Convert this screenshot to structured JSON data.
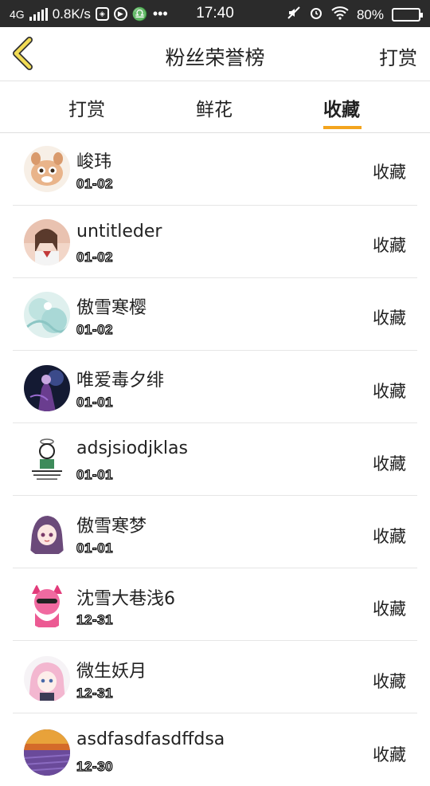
{
  "status_bar": {
    "network": "4G",
    "speed": "0.8K/s",
    "time": "17:40",
    "battery": "80%"
  },
  "header": {
    "title": "粉丝荣誉榜",
    "right_link": "打赏"
  },
  "tabs": [
    {
      "label": "打赏",
      "active": false
    },
    {
      "label": "鲜花",
      "active": false
    },
    {
      "label": "收藏",
      "active": true
    }
  ],
  "list": [
    {
      "name": "峻玮",
      "date": "01-02",
      "action": "收藏",
      "avatar": "cartoon-chipmunk"
    },
    {
      "name": "untitleder",
      "date": "01-02",
      "action": "收藏",
      "avatar": "girl-photo"
    },
    {
      "name": "傲雪寒樱",
      "date": "01-02",
      "action": "收藏",
      "avatar": "abstract-teal"
    },
    {
      "name": "唯爱毒夕绯",
      "date": "01-01",
      "action": "收藏",
      "avatar": "dark-anime-figure"
    },
    {
      "name": "adsjsiodjklas",
      "date": "01-01",
      "action": "收藏",
      "avatar": "doodle-character"
    },
    {
      "name": "傲雪寒梦",
      "date": "01-01",
      "action": "收藏",
      "avatar": "anime-girl-purple"
    },
    {
      "name": "沈雪大巷浅6",
      "date": "12-31",
      "action": "收藏",
      "avatar": "pink-cat-girl"
    },
    {
      "name": "微生妖月",
      "date": "12-31",
      "action": "收藏",
      "avatar": "anime-girl-pink"
    },
    {
      "name": "asdfasdfasdffdsa",
      "date": "12-30",
      "action": "收藏",
      "avatar": "lavender-field"
    }
  ]
}
